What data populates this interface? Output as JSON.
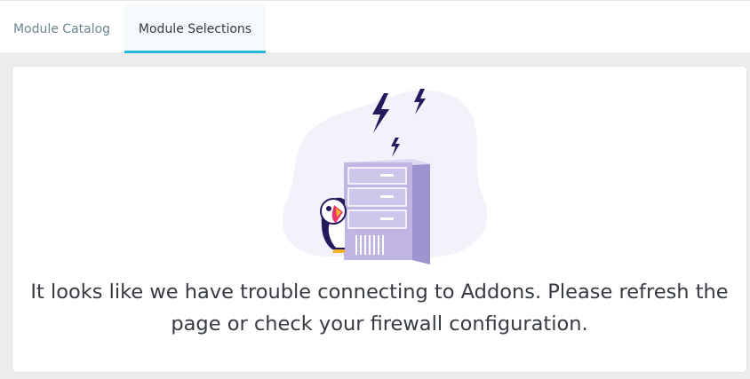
{
  "tabs": {
    "catalog_label": "Module Catalog",
    "selections_label": "Module Selections",
    "active": "Module Selections"
  },
  "error": {
    "message": "It looks like we have trouble connecting to Addons. Please refresh the page or check your firewall configuration.",
    "illustration_icon": "server-disconnected-puffin-icon"
  },
  "colors": {
    "accent": "#25b9d7",
    "text": "#363a41",
    "muted_text": "#6c868e",
    "server": "#c1b5e4",
    "lightning": "#25185c"
  }
}
